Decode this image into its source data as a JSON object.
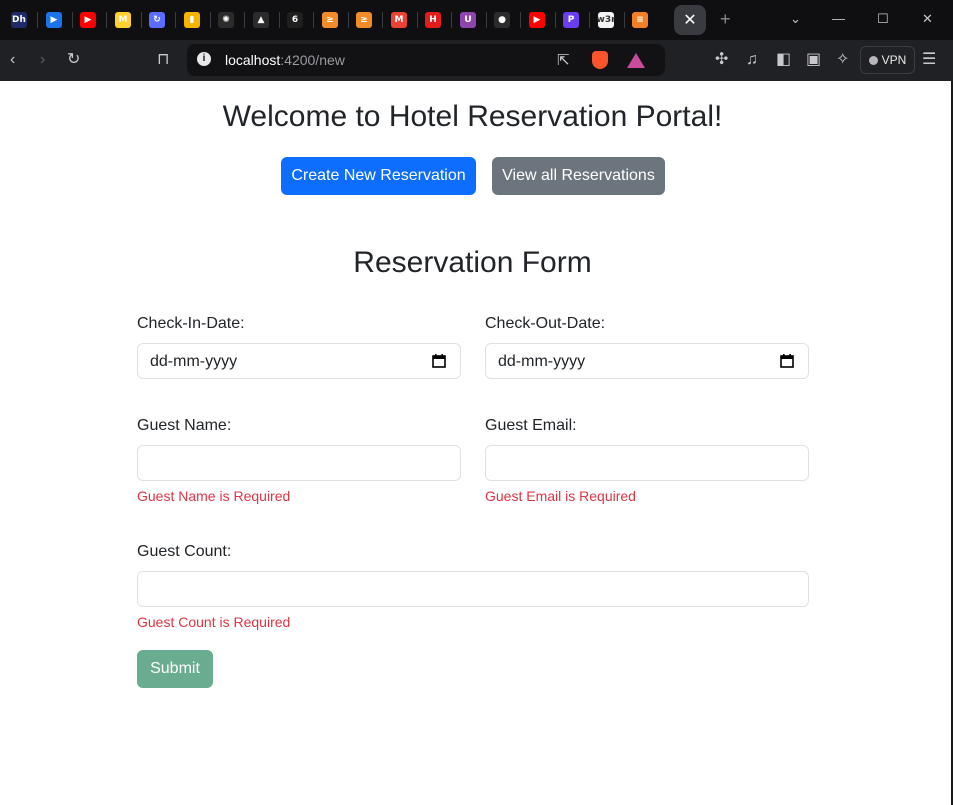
{
  "browser": {
    "tabs": [
      {
        "icon": "devhub-icon",
        "text": "Dh",
        "color": "#1f2a6b"
      },
      {
        "icon": "play-icon",
        "text": "▶",
        "color": "#1a73e8"
      },
      {
        "icon": "youtube-icon",
        "text": "▶",
        "color": "#ff0000"
      },
      {
        "icon": "miro-icon",
        "text": "M",
        "color": "#ffd02f"
      },
      {
        "icon": "sync-icon",
        "text": "↻",
        "color": "#5b6cff"
      },
      {
        "icon": "chart-icon",
        "text": "▮",
        "color": "#f4b400"
      },
      {
        "icon": "openai-icon",
        "text": "✺",
        "color": "#2b2b2b"
      },
      {
        "icon": "mountain-icon",
        "text": "▲",
        "color": "#2b2b2b"
      },
      {
        "icon": "six-icon",
        "text": "6",
        "color": "#1f1f1f"
      },
      {
        "icon": "arrow-icon",
        "text": "≥",
        "color": "#f28c28"
      },
      {
        "icon": "arrow-icon",
        "text": "≥",
        "color": "#f28c28"
      },
      {
        "icon": "gmail-icon",
        "text": "M",
        "color": "#ea4335"
      },
      {
        "icon": "h-icon",
        "text": "H",
        "color": "#e21b1b"
      },
      {
        "icon": "u-icon",
        "text": "U",
        "color": "#8e44ad"
      },
      {
        "icon": "github-icon",
        "text": "●",
        "color": "#2b2b2b"
      },
      {
        "icon": "youtube-icon",
        "text": "▶",
        "color": "#ff0000"
      },
      {
        "icon": "p-icon",
        "text": "P",
        "color": "#6a3df0"
      },
      {
        "icon": "w3r-icon",
        "text": "w3r",
        "color": "#f2f2f2"
      },
      {
        "icon": "stack-icon",
        "text": "≡",
        "color": "#f48024"
      }
    ],
    "url_host": "localhost",
    "url_path": ":4200/new",
    "vpn_label": "VPN"
  },
  "page": {
    "title": "Welcome to Hotel Reservation Portal!",
    "create_button": "Create New Reservation",
    "view_button": "View all Reservations",
    "form_title": "Reservation Form",
    "checkin_label": "Check-In-Date:",
    "checkin_placeholder": "dd-mm-yyyy",
    "checkout_label": "Check-Out-Date:",
    "checkout_placeholder": "dd-mm-yyyy",
    "guest_name_label": "Guest Name:",
    "guest_name_error": "Guest Name is Required",
    "guest_email_label": "Guest Email:",
    "guest_email_error": "Guest Email is Required",
    "guest_count_label": "Guest Count:",
    "guest_count_error": "Guest Count is Required",
    "submit_button": "Submit"
  },
  "colors": {
    "primary": "#0d6efd",
    "secondary": "#6c757d",
    "submit_disabled": "#6aac90",
    "error": "#dc3545"
  }
}
